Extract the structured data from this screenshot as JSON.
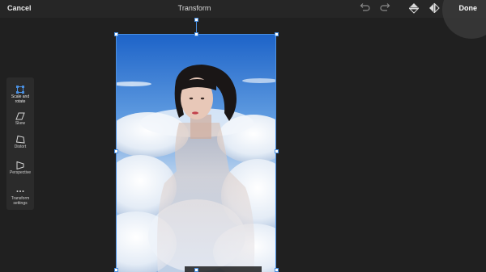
{
  "topbar": {
    "cancel_label": "Cancel",
    "title": "Transform",
    "done_label": "Done",
    "icons": [
      "undo-icon",
      "redo-icon",
      "flip-vertical-icon",
      "flip-horizontal-icon"
    ]
  },
  "palette": {
    "items": [
      {
        "label": "Scale and\nrotate",
        "icon": "scale-rotate-icon",
        "active": true
      },
      {
        "label": "Skew",
        "icon": "skew-icon",
        "active": false
      },
      {
        "label": "Distort",
        "icon": "distort-icon",
        "active": false
      },
      {
        "label": "Perspective",
        "icon": "perspective-icon",
        "active": false
      },
      {
        "label": "Transform\nsettings",
        "icon": "more-icon",
        "active": false
      }
    ]
  },
  "colors": {
    "accent": "#4a90e2",
    "background": "#202020",
    "topbar": "#262626",
    "palette": "#2b2b2b",
    "sky": "#2f78d6"
  }
}
